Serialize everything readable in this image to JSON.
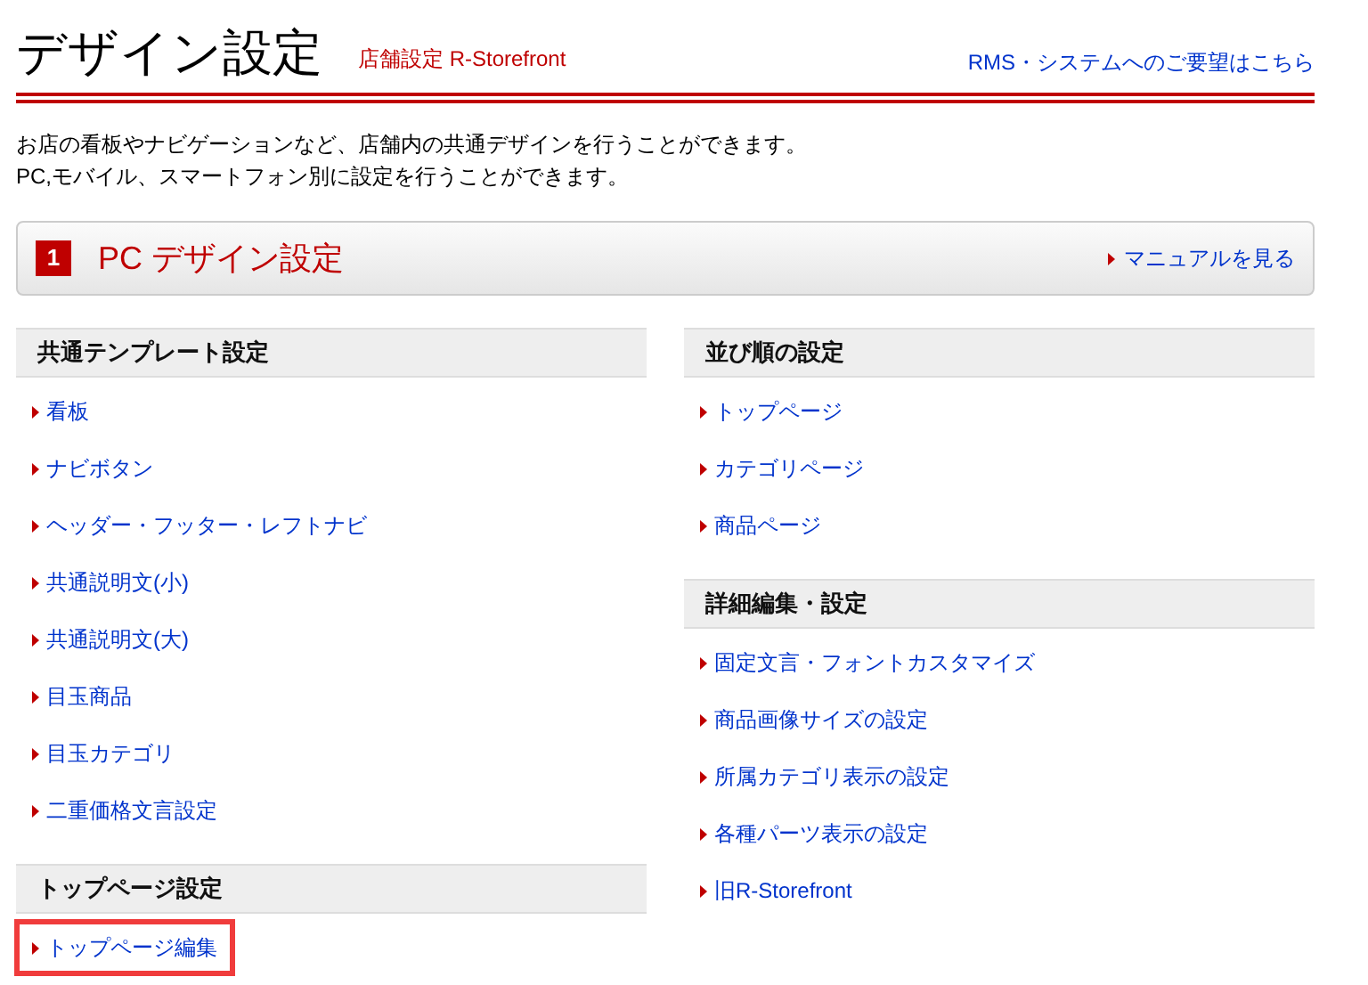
{
  "header": {
    "title": "デザイン設定",
    "subtitle": "店舗設定 R-Storefront",
    "feedback_link": "RMS・システムへのご要望はこちら"
  },
  "intro": [
    "お店の看板やナビゲーションなど、店舗内の共通デザインを行うことができます。",
    "PC,モバイル、スマートフォン別に設定を行うことができます。"
  ],
  "section": {
    "number": "1",
    "title": "PC デザイン設定",
    "manual_link": "マニュアルを見る"
  },
  "columns": [
    [
      {
        "heading": "共通テンプレート設定",
        "links": [
          {
            "label": "看板",
            "highlighted": false
          },
          {
            "label": "ナビボタン",
            "highlighted": false
          },
          {
            "label": "ヘッダー・フッター・レフトナビ",
            "highlighted": false
          },
          {
            "label": "共通説明文(小)",
            "highlighted": false
          },
          {
            "label": "共通説明文(大)",
            "highlighted": false
          },
          {
            "label": "目玉商品",
            "highlighted": false
          },
          {
            "label": "目玉カテゴリ",
            "highlighted": false
          },
          {
            "label": "二重価格文言設定",
            "highlighted": false
          }
        ]
      },
      {
        "heading": "トップページ設定",
        "links": [
          {
            "label": "トップページ編集",
            "highlighted": true
          }
        ]
      }
    ],
    [
      {
        "heading": "並び順の設定",
        "links": [
          {
            "label": "トップページ",
            "highlighted": false
          },
          {
            "label": "カテゴリページ",
            "highlighted": false
          },
          {
            "label": "商品ページ",
            "highlighted": false
          }
        ]
      },
      {
        "heading": "詳細編集・設定",
        "links": [
          {
            "label": "固定文言・フォントカスタマイズ",
            "highlighted": false
          },
          {
            "label": "商品画像サイズの設定",
            "highlighted": false
          },
          {
            "label": "所属カテゴリ表示の設定",
            "highlighted": false
          },
          {
            "label": "各種パーツ表示の設定",
            "highlighted": false
          },
          {
            "label": "旧R-Storefront",
            "highlighted": false
          }
        ]
      }
    ]
  ]
}
